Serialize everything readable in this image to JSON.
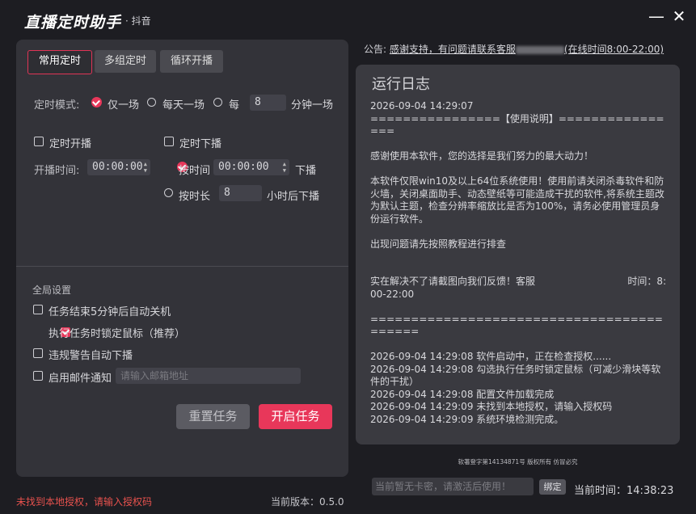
{
  "window": {
    "title": "直播定时助手",
    "subtitle": "· 抖音",
    "minimize_glyph": "—",
    "close_glyph": "✕"
  },
  "tabs": [
    {
      "label": "常用定时",
      "active": true
    },
    {
      "label": "多组定时",
      "active": false
    },
    {
      "label": "循环开播",
      "active": false
    }
  ],
  "mode": {
    "label": "定时模式:",
    "options": [
      "仅一场",
      "每天一场",
      "每"
    ],
    "selected": "仅一场",
    "interval_value": "8",
    "interval_suffix": "分钟一场"
  },
  "start": {
    "checkbox_label": "定时开播",
    "checked": false,
    "time_label": "开播时间:",
    "time_value": "00:00:00"
  },
  "stop": {
    "checkbox_label": "定时下播",
    "checked": false,
    "by_time_label": "按时间",
    "by_time_value": "00:00:00",
    "by_time_suffix": "下播",
    "by_duration_label": "按时长",
    "by_duration_value": "8",
    "by_duration_suffix": "小时后下播",
    "selected": "按时间"
  },
  "global": {
    "section_label": "全局设置",
    "options": [
      {
        "label": "任务结束5分钟后自动关机",
        "checked": false
      },
      {
        "label": "执行任务时锁定鼠标（推荐）",
        "checked": true
      },
      {
        "label": "违规警告自动下播",
        "checked": false
      },
      {
        "label": "启用邮件通知",
        "checked": false
      }
    ],
    "email_placeholder": "请输入邮箱地址"
  },
  "buttons": {
    "reset": "重置任务",
    "start": "开启任务"
  },
  "status": {
    "error_text": "未找到本地授权，请输入授权码",
    "version_text": "当前版本：0.5.0"
  },
  "notice": {
    "prefix": "公告:",
    "link_text": "感谢支持，有问题请联系客服",
    "hours_text": "(在线时间8:00-22:00)"
  },
  "log": {
    "title": "运行日志",
    "lines": [
      "2026-09-04 14:29:07",
      "================【使用说明】================",
      "",
      "感谢使用本软件，您的选择是我们努力的最大动力！",
      "",
      "本软件仅限win10及以上64位系统使用！使用前请关闭杀毒软件和防火墙，关闭桌面助手、动态壁纸等可能造成干扰的软件,将系统主题改为默认主题，检查分辨率缩放比是否为100%，请务必使用管理员身份运行软件。",
      "",
      "出现问题请先按照教程进行排查",
      "",
      "",
      "实在解决不了请截图向我们反馈！客服                              时间：8:00-22:00",
      "",
      "==========================================",
      "",
      "2026-09-04 14:29:08 软件启动中，正在检查授权......",
      "2026-09-04 14:29:08 勾选执行任务时锁定鼠标（可减少滑块等软件的干扰）",
      "2026-09-04 14:29:08 配置文件加载完成",
      "2026-09-04 14:29:09 未找到本地授权，请输入授权码",
      "2026-09-04 14:29:09 系统环境检测完成。"
    ]
  },
  "footer": {
    "copyright": "软著登字第14134871号 版权所有 仿冒必究",
    "code_placeholder": "当前暂无卡密，请激活后使用！",
    "bind_label": "绑定",
    "time_label": "当前时间：",
    "time_value": "14:38:23"
  },
  "colors": {
    "accent": "#e8375a",
    "background": "#1d1d22",
    "panel": "#333339",
    "error": "#e8524e"
  }
}
